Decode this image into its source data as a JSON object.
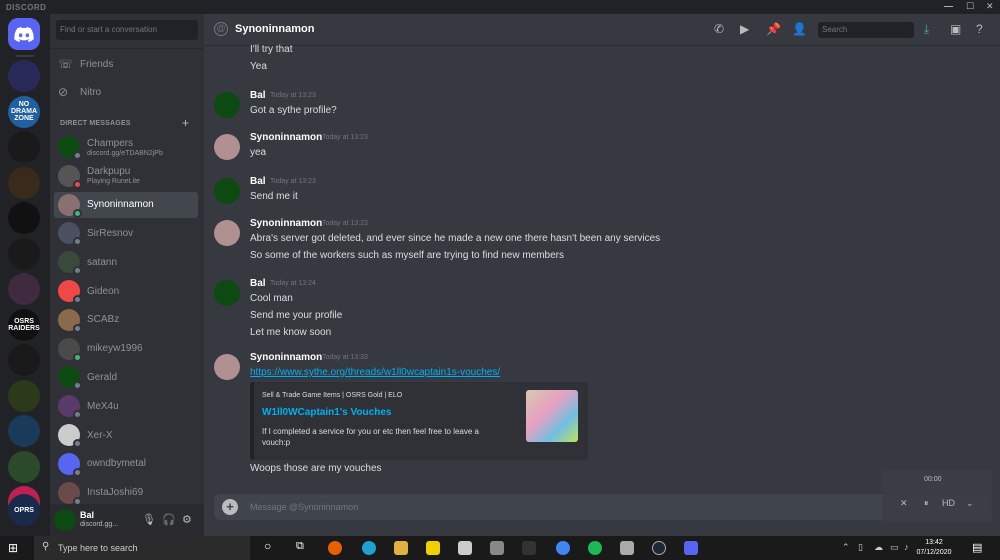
{
  "window": {
    "brand": "DISCORD",
    "controls": [
      "—",
      "☐",
      "✕"
    ]
  },
  "servers": [
    {
      "name": "server-1",
      "label": "",
      "color": "#2a2a5a"
    },
    {
      "name": "no-drama-zone",
      "label": "NO DRAMA ZONE",
      "color": "#2060a0"
    },
    {
      "name": "server-3",
      "label": "",
      "color": "#1a1a1a"
    },
    {
      "name": "server-4",
      "label": "",
      "color": "#3a2a1a"
    },
    {
      "name": "server-5",
      "label": "",
      "color": "#111111"
    },
    {
      "name": "server-6",
      "label": "",
      "color": "#1a1a1a"
    },
    {
      "name": "server-7",
      "label": "",
      "color": "#402a40"
    },
    {
      "name": "osrs-raiders",
      "label": "OSRS RAIDERS",
      "color": "#111111"
    },
    {
      "name": "server-9",
      "label": "",
      "color": "#1a1a1a"
    },
    {
      "name": "server-10",
      "label": "",
      "color": "#2a3a1a"
    },
    {
      "name": "server-11",
      "label": "",
      "color": "#1a3a5a"
    },
    {
      "name": "server-12",
      "label": "",
      "color": "#2a4a2a"
    },
    {
      "name": "server-13",
      "label": "",
      "color": "#c02050"
    },
    {
      "name": "server-14",
      "label": "OPRS",
      "color": "#1a2a4a"
    }
  ],
  "sidebar": {
    "search_placeholder": "Find or start a conversation",
    "friends": "Friends",
    "nitro": "Nitro",
    "dm_header": "DIRECT MESSAGES",
    "dms": [
      {
        "name": "Champers",
        "sub": "discord.gg/eTDABN2jPb",
        "color": "#0c4a12",
        "status": "#747f8d"
      },
      {
        "name": "Darkpupu",
        "sub": "Playing RuneLite",
        "color": "#555555",
        "status": "#f04747"
      },
      {
        "name": "Synoninnamon",
        "sub": "",
        "color": "#8a7070",
        "status": "#43b581",
        "active": true
      },
      {
        "name": "SirResnov",
        "sub": "",
        "color": "#4a5060",
        "status": "#747f8d"
      },
      {
        "name": "satann",
        "sub": "",
        "color": "#3a4a3a",
        "status": "#747f8d"
      },
      {
        "name": "Gideon",
        "sub": "",
        "color": "#f04747",
        "status": "#747f8d"
      },
      {
        "name": "SCABz",
        "sub": "",
        "color": "#8a6a4a",
        "status": "#747f8d"
      },
      {
        "name": "mikeyw1996",
        "sub": "",
        "color": "#4a4a4a",
        "status": "#43b581"
      },
      {
        "name": "Gerald",
        "sub": "",
        "color": "#0c4a12",
        "status": "#747f8d"
      },
      {
        "name": "MeX4u",
        "sub": "",
        "color": "#5a3a6a",
        "status": "#747f8d"
      },
      {
        "name": "Xer-X",
        "sub": "",
        "color": "#cccccc",
        "status": "#747f8d"
      },
      {
        "name": "owndbymetal",
        "sub": "",
        "color": "#5865f2",
        "status": "#747f8d"
      },
      {
        "name": "InstaJoshi69",
        "sub": "",
        "color": "#6a4a4a",
        "status": "#747f8d"
      }
    ]
  },
  "user": {
    "name": "Bal",
    "status": "discord.gg..."
  },
  "chat": {
    "title": "Synoninnamon",
    "search_placeholder": "Search",
    "composer_placeholder": "Message @Synoninnamon",
    "messages": [
      {
        "cont": true,
        "lines": [
          "I'll try that",
          "Yea"
        ]
      },
      {
        "author": "Bal",
        "time": "Today at 13:23",
        "lines": [
          "Got a sythe profile?"
        ]
      },
      {
        "author": "Synoninnamon",
        "time": "Today at 13:23",
        "lines": [
          "yea"
        ]
      },
      {
        "author": "Bal",
        "time": "Today at 13:23",
        "lines": [
          "Send me it"
        ]
      },
      {
        "author": "Synoninnamon",
        "time": "Today at 13:23",
        "lines": [
          "Abra's server got deleted, and ever since he made a new one there hasn't been any services",
          "So some of the workers such as myself are trying to find new members"
        ]
      },
      {
        "author": "Bal",
        "time": "Today at 13:24",
        "lines": [
          "Cool man",
          "Send me your profile",
          "Let me know soon"
        ]
      },
      {
        "author": "Synoninnamon",
        "time": "Today at 13:33",
        "link": "https://www.sythe.org/threads/w1ll0wcaptain1s-vouches/",
        "lines": [
          "Woops those are my vouches"
        ]
      }
    ],
    "embed": {
      "provider": "Sell & Trade Game Items | OSRS Gold | ELO",
      "title": "W1ll0WCaptain1's Vouches",
      "description": "If I completed a service for you or etc then feel free to leave a vouch:p"
    }
  },
  "video_overlay": {
    "time": "00:00",
    "controls": [
      "✕",
      "⏸",
      "HD",
      "⌄"
    ]
  },
  "taskbar": {
    "search_placeholder": "Type here to search",
    "time": "13:42",
    "date": "07/12/2020"
  },
  "colors": {
    "accent": "#5865f2",
    "link": "#00b0f4",
    "online": "#43b581",
    "dnd": "#f04747",
    "offline": "#747f8d"
  }
}
